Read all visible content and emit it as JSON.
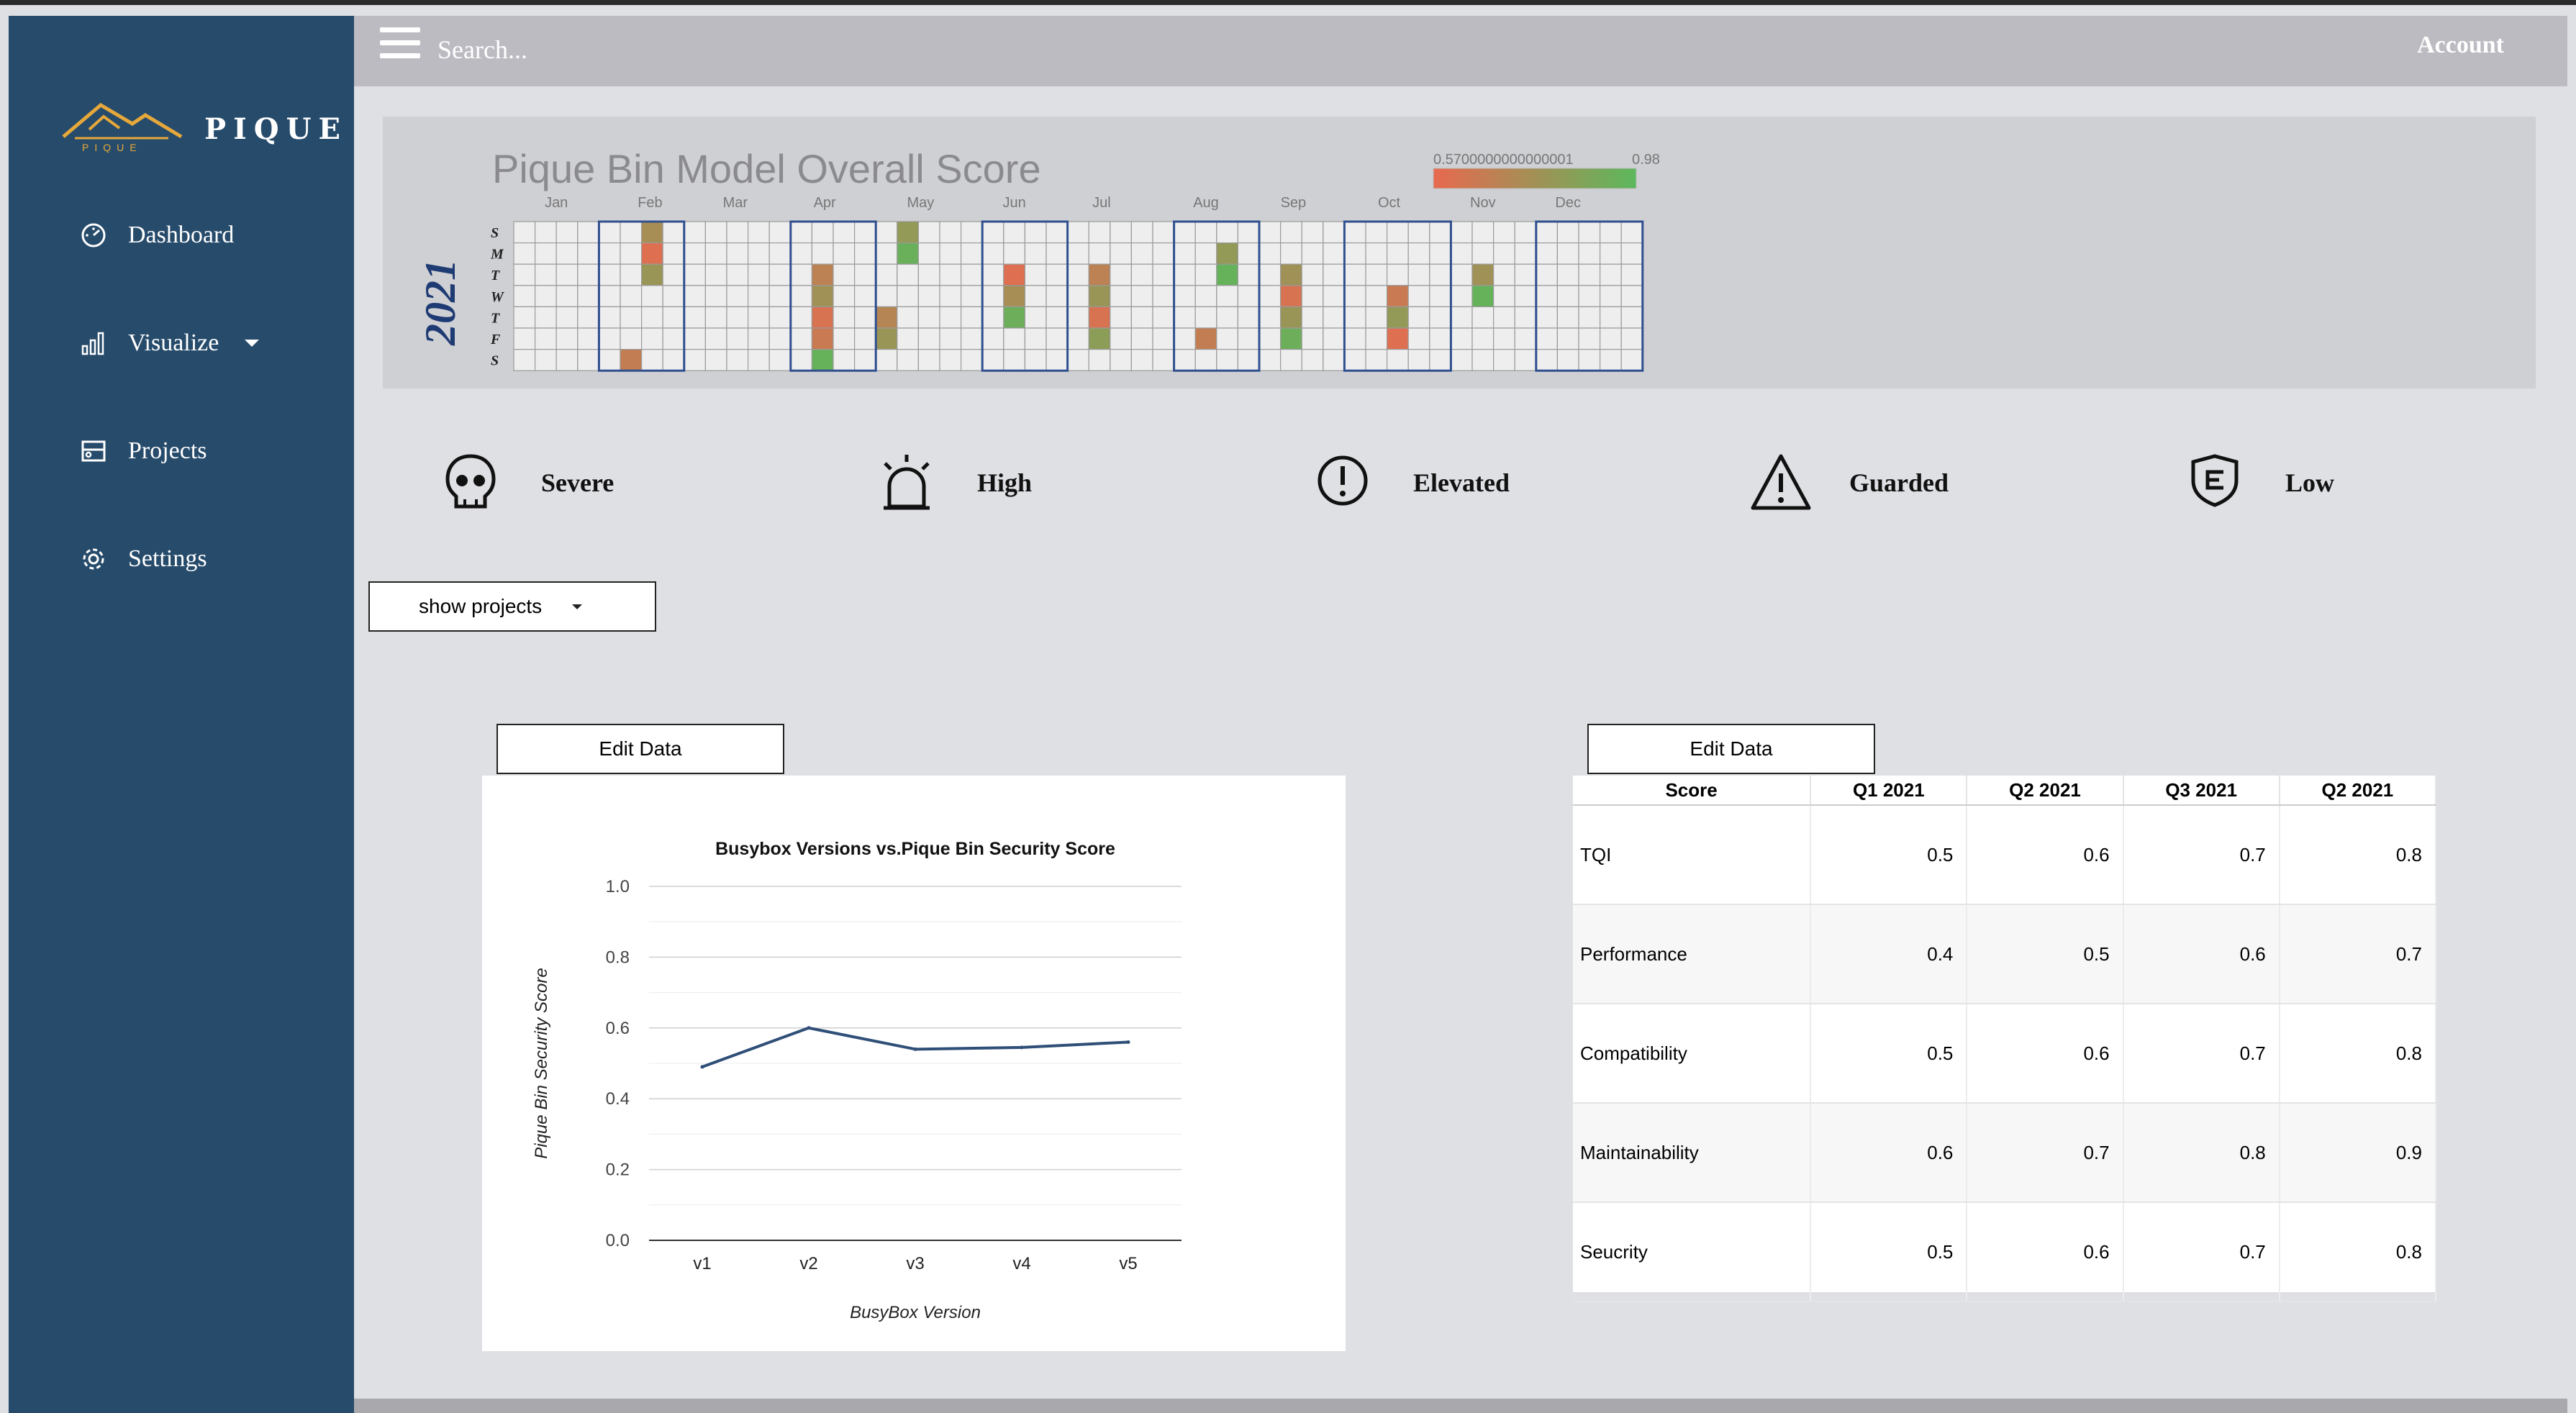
{
  "app": {
    "logo_icon": "pique-mountain-logo",
    "logo_subtext": "PIQUE",
    "name": "PIQUE"
  },
  "topbar": {
    "menu_icon": "hamburger-icon",
    "search_placeholder": "Search...",
    "account_label": "Account"
  },
  "sidebar": {
    "items": [
      {
        "label": "Dashboard",
        "icon": "speedometer-icon"
      },
      {
        "label": "Visualize",
        "icon": "bar-chart-icon",
        "has_dropdown": true
      },
      {
        "label": "Projects",
        "icon": "projects-icon"
      },
      {
        "label": "Settings",
        "icon": "gear-icon"
      }
    ]
  },
  "calendar": {
    "title": "Pique Bin Model Overall Score",
    "year": "2021",
    "months": [
      "Jan",
      "Feb",
      "Mar",
      "Apr",
      "May",
      "Jun",
      "Jul",
      "Aug",
      "Sep",
      "Oct",
      "Nov",
      "Dec"
    ],
    "day_labels": [
      "S",
      "M",
      "T",
      "W",
      "T",
      "F",
      "S"
    ],
    "legend_min": "0.5700000000000001",
    "legend_max": "0.98",
    "color_low": "#e8694f",
    "color_high": "#5cb85c",
    "cells": [
      {
        "week": 6,
        "day": 0,
        "value": 0.76
      },
      {
        "week": 6,
        "day": 1,
        "value": 0.6
      },
      {
        "week": 6,
        "day": 2,
        "value": 0.8
      },
      {
        "week": 5,
        "day": 6,
        "value": 0.68
      },
      {
        "week": 14,
        "day": 2,
        "value": 0.7
      },
      {
        "week": 14,
        "day": 3,
        "value": 0.78
      },
      {
        "week": 14,
        "day": 4,
        "value": 0.62
      },
      {
        "week": 14,
        "day": 5,
        "value": 0.66
      },
      {
        "week": 14,
        "day": 6,
        "value": 0.95
      },
      {
        "week": 18,
        "day": 0,
        "value": 0.82
      },
      {
        "week": 18,
        "day": 1,
        "value": 0.94
      },
      {
        "week": 17,
        "day": 4,
        "value": 0.72
      },
      {
        "week": 17,
        "day": 5,
        "value": 0.8
      },
      {
        "week": 23,
        "day": 2,
        "value": 0.6
      },
      {
        "week": 23,
        "day": 3,
        "value": 0.76
      },
      {
        "week": 23,
        "day": 4,
        "value": 0.93
      },
      {
        "week": 27,
        "day": 2,
        "value": 0.7
      },
      {
        "week": 27,
        "day": 3,
        "value": 0.8
      },
      {
        "week": 27,
        "day": 4,
        "value": 0.62
      },
      {
        "week": 27,
        "day": 5,
        "value": 0.84
      },
      {
        "week": 32,
        "day": 5,
        "value": 0.68
      },
      {
        "week": 33,
        "day": 1,
        "value": 0.82
      },
      {
        "week": 33,
        "day": 2,
        "value": 0.95
      },
      {
        "week": 36,
        "day": 2,
        "value": 0.78
      },
      {
        "week": 36,
        "day": 3,
        "value": 0.62
      },
      {
        "week": 36,
        "day": 4,
        "value": 0.8
      },
      {
        "week": 36,
        "day": 5,
        "value": 0.93
      },
      {
        "week": 41,
        "day": 3,
        "value": 0.66
      },
      {
        "week": 41,
        "day": 4,
        "value": 0.82
      },
      {
        "week": 41,
        "day": 5,
        "value": 0.6
      },
      {
        "week": 45,
        "day": 2,
        "value": 0.78
      },
      {
        "week": 45,
        "day": 3,
        "value": 0.95
      }
    ]
  },
  "threat_levels": [
    {
      "label": "Severe",
      "color": "#bf2537",
      "icon": "skull-icon"
    },
    {
      "label": "High",
      "color": "#ee7131",
      "icon": "alarm-icon"
    },
    {
      "label": "Elevated",
      "color": "#f9de4c",
      "icon": "exclamation-circle-icon"
    },
    {
      "label": "Guarded",
      "color": "#3f69c7",
      "icon": "warning-triangle-icon"
    },
    {
      "label": "Low",
      "color": "#3f976a",
      "icon": "shield-icon"
    }
  ],
  "projects_dropdown": {
    "label": "show projects"
  },
  "edit_data_label": "Edit Data",
  "chart_data": {
    "type": "line",
    "title": "Busybox Versions vs.Pique Bin Security Score",
    "xlabel": "BusyBox Version",
    "ylabel": "Pique Bin Security Score",
    "categories": [
      "v1",
      "v2",
      "v3",
      "v4",
      "v5"
    ],
    "values": [
      0.49,
      0.6,
      0.54,
      0.545,
      0.56
    ],
    "ylim": [
      0,
      1.0
    ],
    "yticks": [
      "0.0",
      "0.2",
      "0.4",
      "0.6",
      "0.8",
      "1.0"
    ],
    "line_color": "#2f4f78",
    "grid": true
  },
  "score_table": {
    "columns": [
      "Score",
      "Q1 2021",
      "Q2 2021",
      "Q3 2021",
      "Q2 2021"
    ],
    "rows": [
      [
        "TQI",
        "0.5",
        "0.6",
        "0.7",
        "0.8"
      ],
      [
        "Performance",
        "0.4",
        "0.5",
        "0.6",
        "0.7"
      ],
      [
        "Compatibility",
        "0.5",
        "0.6",
        "0.7",
        "0.8"
      ],
      [
        "Maintainability",
        "0.6",
        "0.7",
        "0.8",
        "0.9"
      ],
      [
        "Seucrity",
        "0.5",
        "0.6",
        "0.7",
        "0.8"
      ]
    ]
  }
}
